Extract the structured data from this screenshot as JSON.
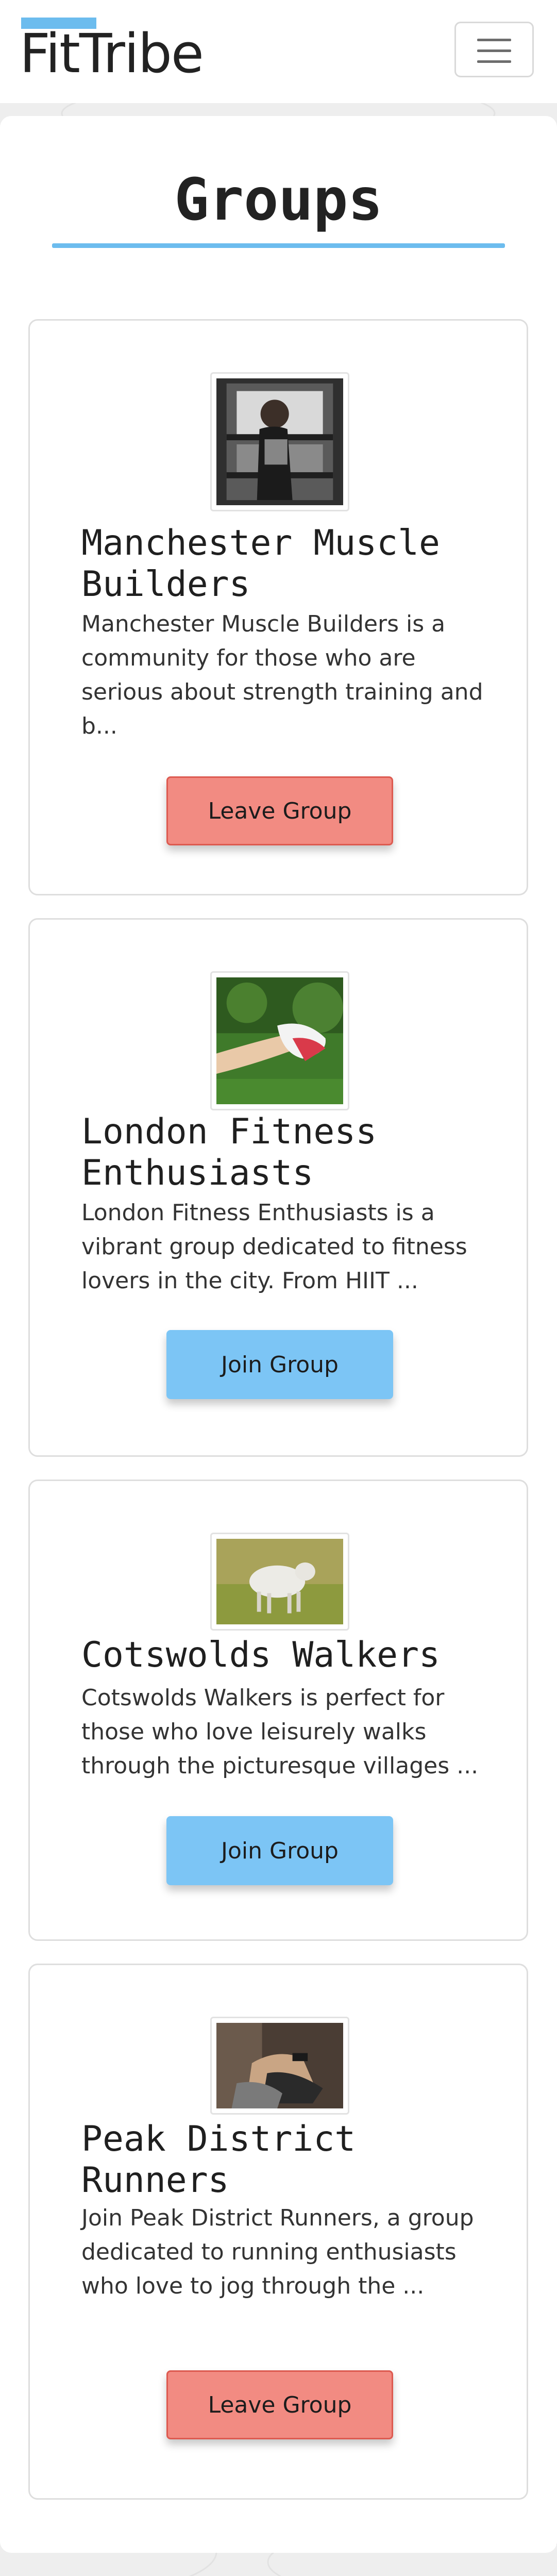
{
  "navbar": {
    "brand": "FitTribe",
    "menu_icon": "hamburger-menu-icon",
    "brand_accent": "#6cbcee"
  },
  "page": {
    "title": "Groups",
    "accent_color": "#6cbcee"
  },
  "groups": [
    {
      "name": "Manchester Muscle Builders",
      "description": "Manchester Muscle Builders is a community for those who are serious about strength training and b...",
      "button_label": "Leave Group",
      "button_color": "#f28b82"
    },
    {
      "name": "London Fitness Enthusiasts",
      "description": "London Fitness Enthusiasts is a vibrant group dedicated to fitness lovers in the city. From HIIT ...",
      "button_label": "Join Group",
      "button_color": "#7cc5f5"
    },
    {
      "name": "Cotswolds Walkers",
      "description": "Cotswolds Walkers is perfect for those who love leisurely walks through the picturesque villages ...",
      "button_label": "Join Group",
      "button_color": "#7cc5f5"
    },
    {
      "name": "Peak District Runners",
      "description": "Join Peak District Runners, a group dedicated to running enthusiasts who love to jog through the ...",
      "button_label": "Leave Group",
      "button_color": "#f28b82"
    }
  ]
}
